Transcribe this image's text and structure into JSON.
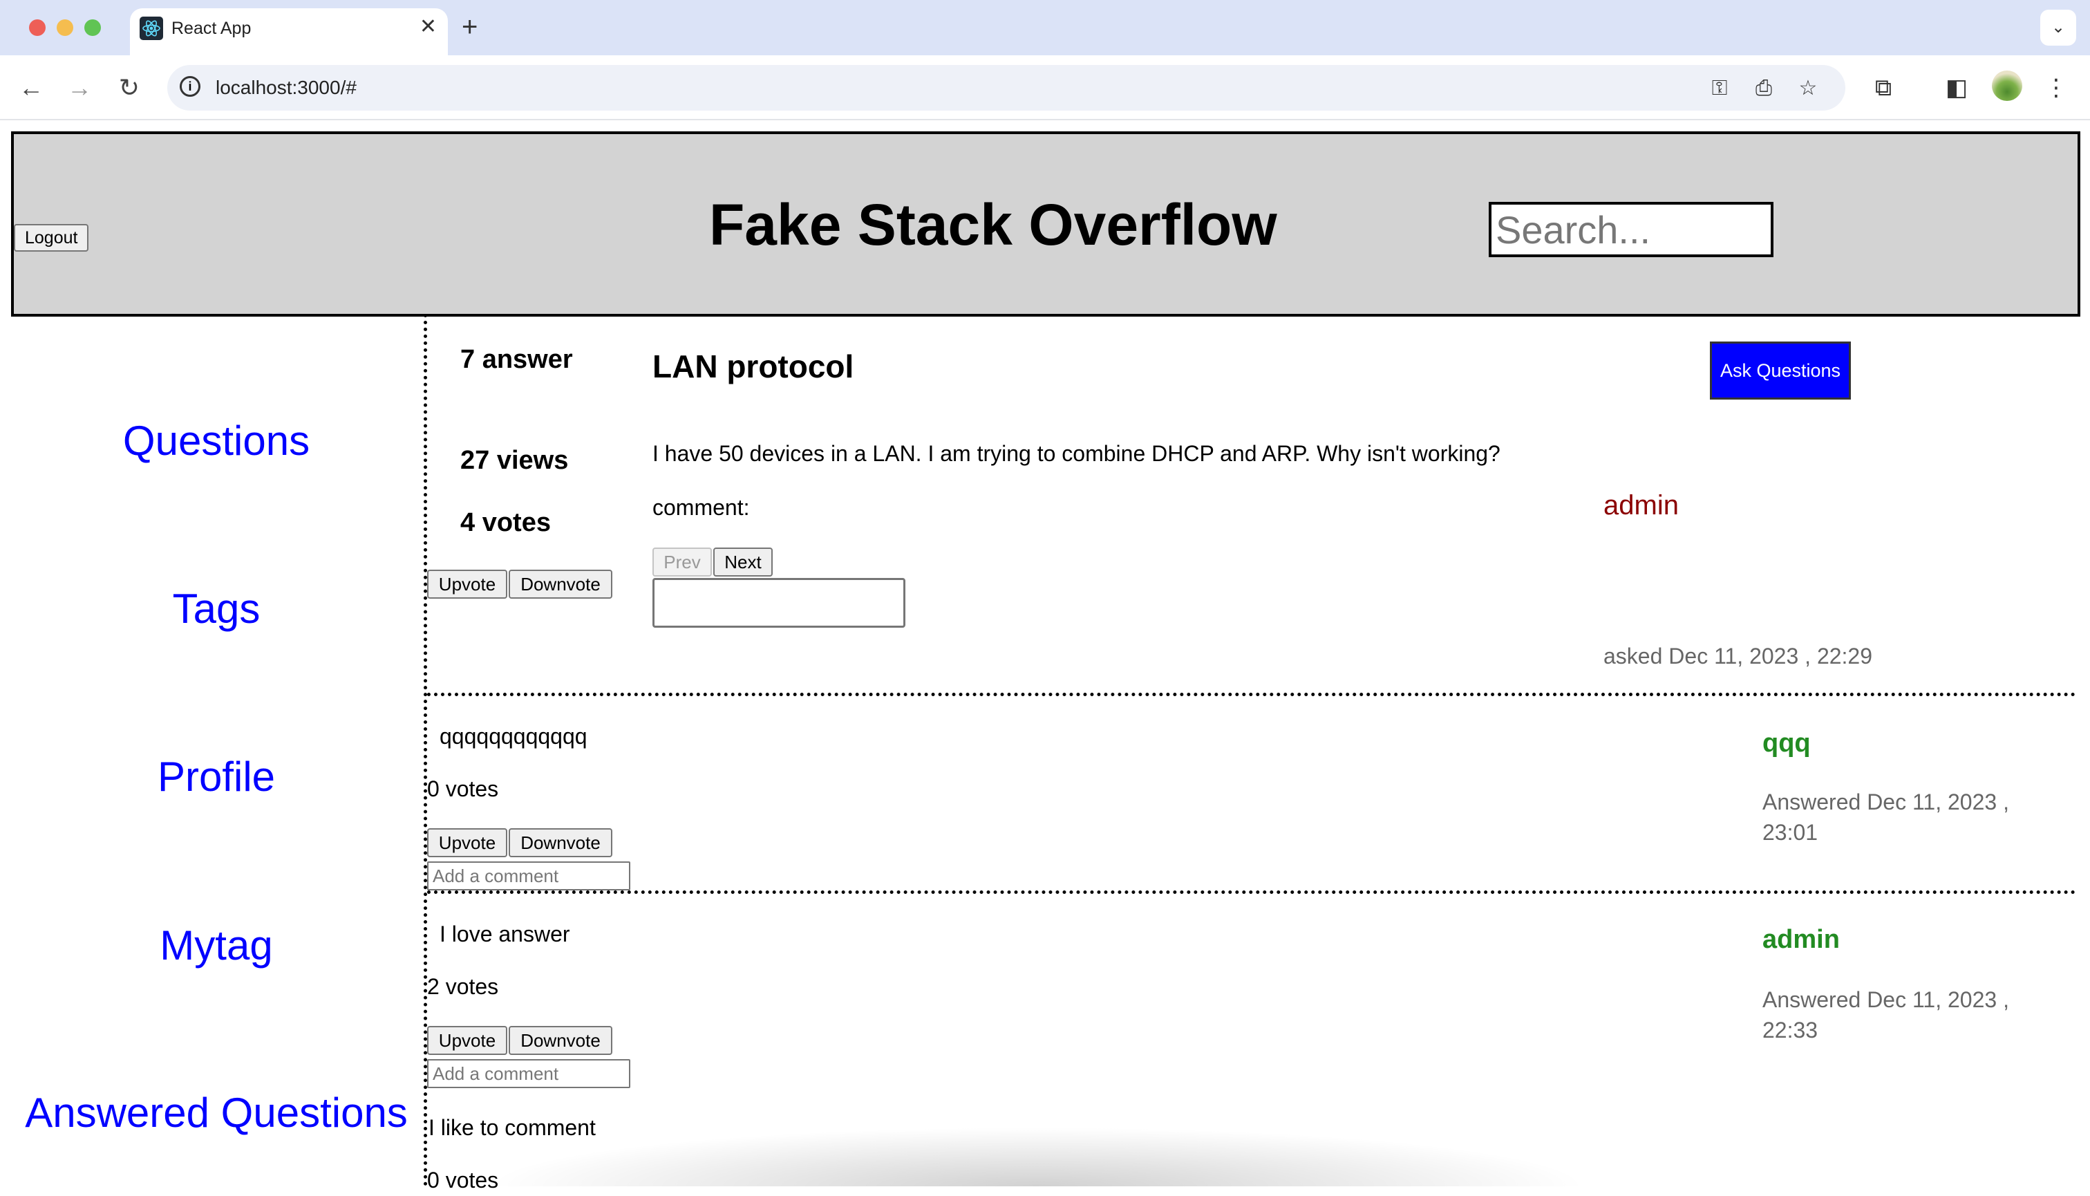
{
  "browser": {
    "tab_title": "React App",
    "url": "localhost:3000/#",
    "new_tab_symbol": "+",
    "tab_close_symbol": "✕"
  },
  "header": {
    "logout_label": "Logout",
    "title": "Fake Stack Overflow",
    "search_placeholder": "Search..."
  },
  "sidebar": {
    "items": [
      {
        "label": "Questions"
      },
      {
        "label": "Tags"
      },
      {
        "label": "Profile"
      },
      {
        "label": "Mytag"
      },
      {
        "label": "Answered Questions"
      }
    ]
  },
  "question": {
    "answers": "7 answer",
    "views": "27 views",
    "votes": "4 votes",
    "title": "LAN protocol",
    "text": "I have 50 devices in a LAN. I am trying to combine DHCP and ARP. Why isn't working?",
    "comment_label": "comment:",
    "author": "admin",
    "date": "asked Dec 11, 2023 , 22:29",
    "upvote_label": "Upvote",
    "downvote_label": "Downvote",
    "prev_label": "Prev",
    "next_label": "Next",
    "ask_button": "Ask Questions"
  },
  "answers": [
    {
      "text": "qqqqqqqqqqqq",
      "votes": "0 votes",
      "author": "qqq",
      "date_line1": "Answered Dec 11, 2023 ,",
      "date_line2": "23:01",
      "comment_placeholder": "Add a comment",
      "upvote_label": "Upvote",
      "downvote_label": "Downvote"
    },
    {
      "text": "I love answer",
      "votes": "2 votes",
      "author": "admin",
      "date_line1": "Answered Dec 11, 2023 ,",
      "date_line2": "22:33",
      "comment_placeholder": "Add a comment",
      "upvote_label": "Upvote",
      "downvote_label": "Downvote"
    },
    {
      "text": "I like to comment",
      "votes": "0 votes"
    }
  ],
  "colors": {
    "link_blue": "#0000ff",
    "ask_button_bg": "#0000ff",
    "question_author": "#8b0000",
    "answer_author": "#228b22",
    "header_bg": "#d3d3d3"
  }
}
